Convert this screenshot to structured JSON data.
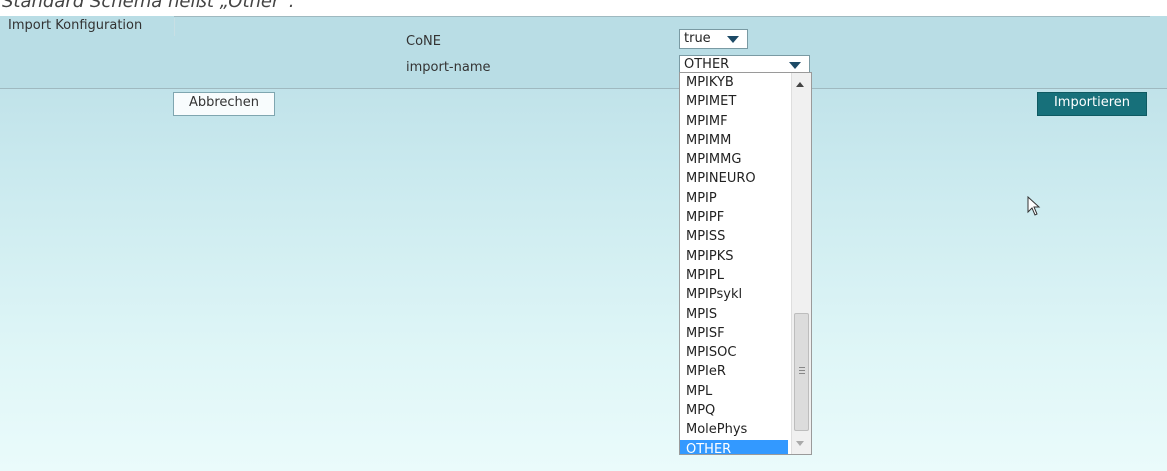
{
  "caption": "Standard Schema heißt „Other“.",
  "section_label": "Import Konfiguration",
  "fields": {
    "cone_label": "CoNE",
    "cone_value": "true",
    "import_name_label": "import-name",
    "import_name_value": "OTHER"
  },
  "buttons": {
    "cancel": "Abbrechen",
    "import": "Importieren"
  },
  "dropdown": {
    "options": [
      "MPIKYB",
      "MPIMET",
      "MPIMF",
      "MPIMM",
      "MPIMMG",
      "MPINEURO",
      "MPIP",
      "MPIPF",
      "MPISS",
      "MPIPKS",
      "MPIPL",
      "MPIPsykl",
      "MPIS",
      "MPISF",
      "MPISOC",
      "MPIeR",
      "MPL",
      "MPQ",
      "MolePhys",
      "OTHER"
    ],
    "selected": "OTHER"
  },
  "icons": {
    "select_arrow": "chevron-down-icon",
    "cursor": "mouse-pointer-icon"
  },
  "colors": {
    "header_band": "#b9dde5",
    "import_button": "#17707a",
    "selected_option": "#3399ff"
  }
}
